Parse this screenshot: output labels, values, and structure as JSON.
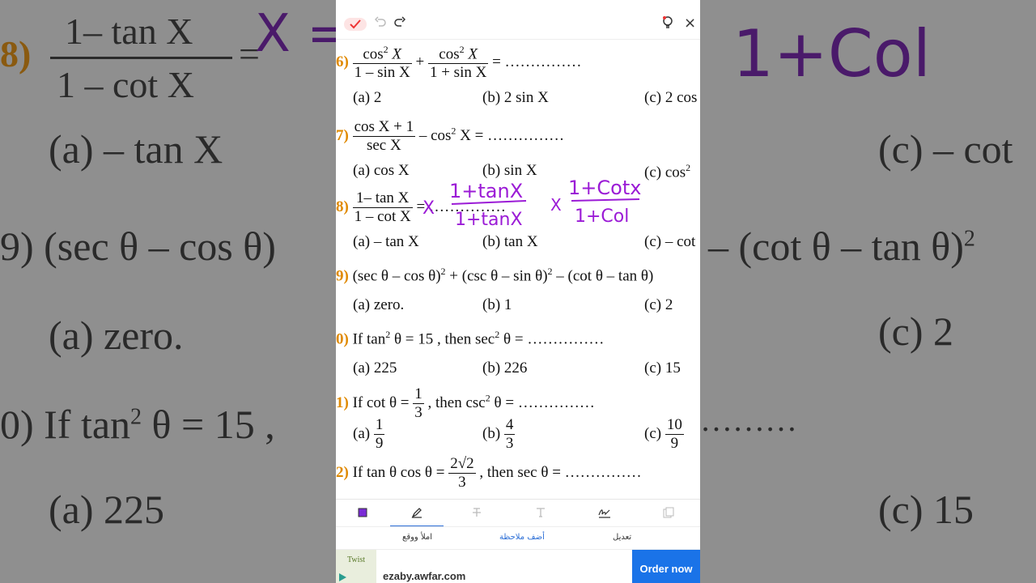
{
  "background_left": {
    "q8_num": "8)",
    "q8_top": "1– tan X",
    "q8_bottom": "1 – cot X",
    "q8_eq": "=",
    "q8_ink": "X =",
    "q8_a": "(a) – tan X",
    "q9": "9) (sec θ – cos θ)",
    "q9_a": "(a) zero.",
    "q10": "0) If tan",
    "q10_sup": "2",
    "q10_rest": "θ = 15 ,",
    "q10_a": "(a) 225"
  },
  "background_right": {
    "c1": "(c) – cot",
    "c2": "– (cot θ – tan θ)",
    "c2_sup": "2",
    "c3": "(c) 2",
    "dots": "………",
    "c4": "(c) 15",
    "ink": "1+Col"
  },
  "toolbar_top": {
    "undo_icon": "undo-icon",
    "redo_icon": "redo-icon",
    "close": "×"
  },
  "questions": {
    "q6": {
      "num": "6)",
      "f1_top": "cos",
      "f1_sup": "2",
      "f1_var": "X",
      "f1_bot": "1 – sin X",
      "plus": "+",
      "f2_top": "cos",
      "f2_sup": "2",
      "f2_var": "X",
      "f2_bot": "1 + sin X",
      "eq": "= ……………",
      "a": "(a) 2",
      "b": "(b) 2 sin X",
      "c": "(c) 2 cos"
    },
    "q7": {
      "num": "7)",
      "top": "cos X + 1",
      "bot": "sec X",
      "rest": "– cos",
      "sup": "2",
      "rest2": "X = ……………",
      "a": "(a) cos X",
      "b": "(b) sin X",
      "c": "(c) cos",
      "c_sup": "2"
    },
    "q8": {
      "num": "8)",
      "top": "1– tan X",
      "bot": "1 – cot X",
      "rest": "= ……………",
      "a": "(a) – tan X",
      "b": "(b) tan X",
      "c": "(c) – cot"
    },
    "q9": {
      "num": "9)",
      "p1": "(sec θ – cos θ)",
      "s1": "2",
      "p2": "+ (csc θ – sin θ)",
      "s2": "2",
      "p3": "– (cot θ – tan θ)",
      "a": "(a) zero.",
      "b": "(b) 1",
      "c": "(c) 2"
    },
    "q10": {
      "num": "0)",
      "p1": "If tan",
      "s1": "2",
      "p2": "θ = 15 , then sec",
      "s2": "2",
      "p3": "θ = ……………",
      "a": "(a) 225",
      "b": "(b) 226",
      "c": "(c) 15"
    },
    "q11": {
      "num": "1)",
      "p1": "If cot θ =",
      "ftop": "1",
      "fbot": "3",
      "p2": ", then csc",
      "s2": "2",
      "p3": "θ = ……………",
      "a_label": "(a)",
      "a_top": "1",
      "a_bot": "9",
      "b_label": "(b)",
      "b_top": "4",
      "b_bot": "3",
      "c_label": "(c)",
      "c_top": "10",
      "c_bot": "9"
    },
    "q12": {
      "num": "2)",
      "p1": "If tan θ cos θ =",
      "ftop": "2√2",
      "fbot": "3",
      "p2": ", then sec θ = ……………"
    }
  },
  "annotations": {
    "ink1": "X",
    "ink2_top": "1+tanX",
    "ink2_bot": "1+tanX",
    "ink3": "X",
    "ink4_top": "1+Cotx",
    "ink4_bot": "1+Col",
    "ink_color": "#9b1bd6"
  },
  "tools": [
    "shape-icon",
    "pen-icon",
    "strike-icon",
    "text-icon",
    "sign-icon",
    "copy-icon"
  ],
  "actions": {
    "sign": "املأ ووقع",
    "note": "أضف ملاحظة",
    "edit": "تعديل",
    "note_color": "#2b6ed6"
  },
  "ad": {
    "logo": "Twist",
    "url": "ezaby.awfar.com",
    "button": "Order now",
    "button_color": "#1a73e8"
  }
}
